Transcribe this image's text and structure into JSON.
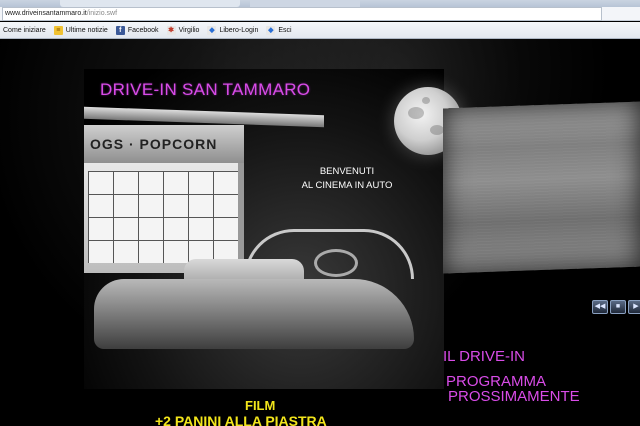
{
  "browser": {
    "url_domain": "www.driveinsantammaro.it",
    "url_path": "/inizio.swf",
    "bookmarks": [
      {
        "label": "Come iniziare",
        "icon": "none"
      },
      {
        "label": "Ultime notizie",
        "icon": "news-icon"
      },
      {
        "label": "Facebook",
        "icon": "facebook-icon"
      },
      {
        "label": "Virgilio",
        "icon": "virgilio-icon"
      },
      {
        "label": "Libero-Login",
        "icon": "libero-icon"
      },
      {
        "label": "Esci",
        "icon": "esci-icon"
      }
    ]
  },
  "site": {
    "title": "DRIVE-IN SAN TAMMARO",
    "welcome_line1": "BENVENUTI",
    "welcome_line2": "AL CINEMA IN AUTO",
    "photo_sign": "OGS · POPCORN"
  },
  "player": {
    "controls": [
      "rewind-icon",
      "stop-icon",
      "play-icon"
    ]
  },
  "menu": {
    "drive_in": "IL DRIVE-IN",
    "programma": "PROGRAMMA",
    "prossimamente": "PROSSIMAMENTE"
  },
  "promo": {
    "line1": "FILM",
    "line2": "+2 PANINI ALLA PIASTRA"
  },
  "colors": {
    "menu": "#d94ce8",
    "promo": "#f2e51b",
    "background": "#000000"
  }
}
